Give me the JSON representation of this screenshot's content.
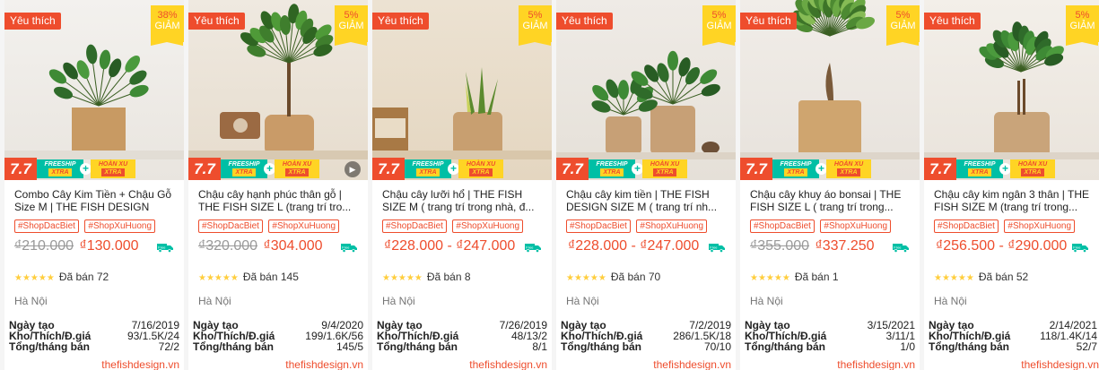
{
  "badges": {
    "favorite": "Yêu thích",
    "off_label": "GIẢM",
    "promo_77": "7.7",
    "freeship_top": "FREESHIP",
    "freeship_xtra": "XTRA",
    "hoanxu_top": "HOÀN XU",
    "hoanxu_xtra": "XTRA"
  },
  "stats_labels": {
    "created": "Ngày tạo",
    "stock": "Kho/Thích/Đ.giá",
    "sold_month": "Tổng/tháng bán"
  },
  "products": [
    {
      "discount": "38%",
      "title_line1": "Combo Cây Kim Tiền + Chậu Gỗ",
      "title_line2": "Size M | THE FISH DESIGN",
      "tag1": "#ShopDacBiet",
      "tag2": "#ShopXuHuong",
      "old_price": "₫210.000",
      "price": "₫130.000",
      "stars": "★★★★★",
      "sold": "Đã bán 72",
      "location": "Hà Nội",
      "created": "7/16/2019",
      "stock": "93/1.5K/24",
      "sold_month": "72/2",
      "site": "thefishdesign.vn"
    },
    {
      "discount": "5%",
      "title_line1": "Chậu cây hạnh phúc thân gỗ |",
      "title_line2": "THE FISH SIZE L (trang trí tro...",
      "tag1": "#ShopDacBiet",
      "tag2": "#ShopXuHuong",
      "old_price": "₫320.000",
      "price": "₫304.000",
      "stars": "★★★★★",
      "sold": "Đã bán 145",
      "location": "Hà Nội",
      "created": "9/4/2020",
      "stock": "199/1.6K/56",
      "sold_month": "145/5",
      "site": "thefishdesign.vn"
    },
    {
      "discount": "5%",
      "title_line1": "Chậu cây lưỡi hổ | THE FISH",
      "title_line2": "SIZE M ( trang trí trong nhà, đ...",
      "tag1": "#ShopDacBiet",
      "tag2": "#ShopXuHuong",
      "old_price": "",
      "price": "₫228.000 - ₫247.000",
      "stars": "★★★★★",
      "sold": "Đã bán 8",
      "location": "Hà Nội",
      "created": "7/26/2019",
      "stock": "48/13/2",
      "sold_month": "8/1",
      "site": "thefishdesign.vn"
    },
    {
      "discount": "5%",
      "title_line1": "Chậu cây kim tiền | THE FISH",
      "title_line2": "DESIGN SIZE M ( trang trí nh...",
      "tag1": "#ShopDacBiet",
      "tag2": "#ShopXuHuong",
      "old_price": "",
      "price": "₫228.000 - ₫247.000",
      "stars": "★★★★★",
      "sold": "Đã bán 70",
      "location": "Hà Nội",
      "created": "7/2/2019",
      "stock": "286/1.5K/18",
      "sold_month": "70/10",
      "site": "thefishdesign.vn"
    },
    {
      "discount": "5%",
      "title_line1": "Chậu cây khuy áo bonsai | THE",
      "title_line2": "FISH SIZE L ( trang trí trong...",
      "tag1": "#ShopDacBiet",
      "tag2": "#ShopXuHuong",
      "old_price": "₫355.000",
      "price": "₫337.250",
      "stars": "★★★★★",
      "sold": "Đã bán 1",
      "location": "Hà Nội",
      "created": "3/15/2021",
      "stock": "3/11/1",
      "sold_month": "1/0",
      "site": "thefishdesign.vn"
    },
    {
      "discount": "5%",
      "title_line1": "Chậu cây kim ngân 3 thân | THE",
      "title_line2": "FISH SIZE M (trang trí trong...",
      "tag1": "#ShopDacBiet",
      "tag2": "#ShopXuHuong",
      "old_price": "",
      "price": "₫256.500 - ₫290.000",
      "stars": "★★★★★",
      "sold": "Đã bán 52",
      "location": "Hà Nội",
      "created": "2/14/2021",
      "stock": "118/1.4K/14",
      "sold_month": "52/7",
      "site": "thefishdesign.vn"
    }
  ],
  "colors": {
    "brand": "#ee4d2d",
    "teal": "#00bfa5",
    "yellow": "#ffd424",
    "star": "#ffce3d"
  },
  "icons": [
    "truck-free-icon",
    "play-icon",
    "plus-icon",
    "star-icon"
  ]
}
